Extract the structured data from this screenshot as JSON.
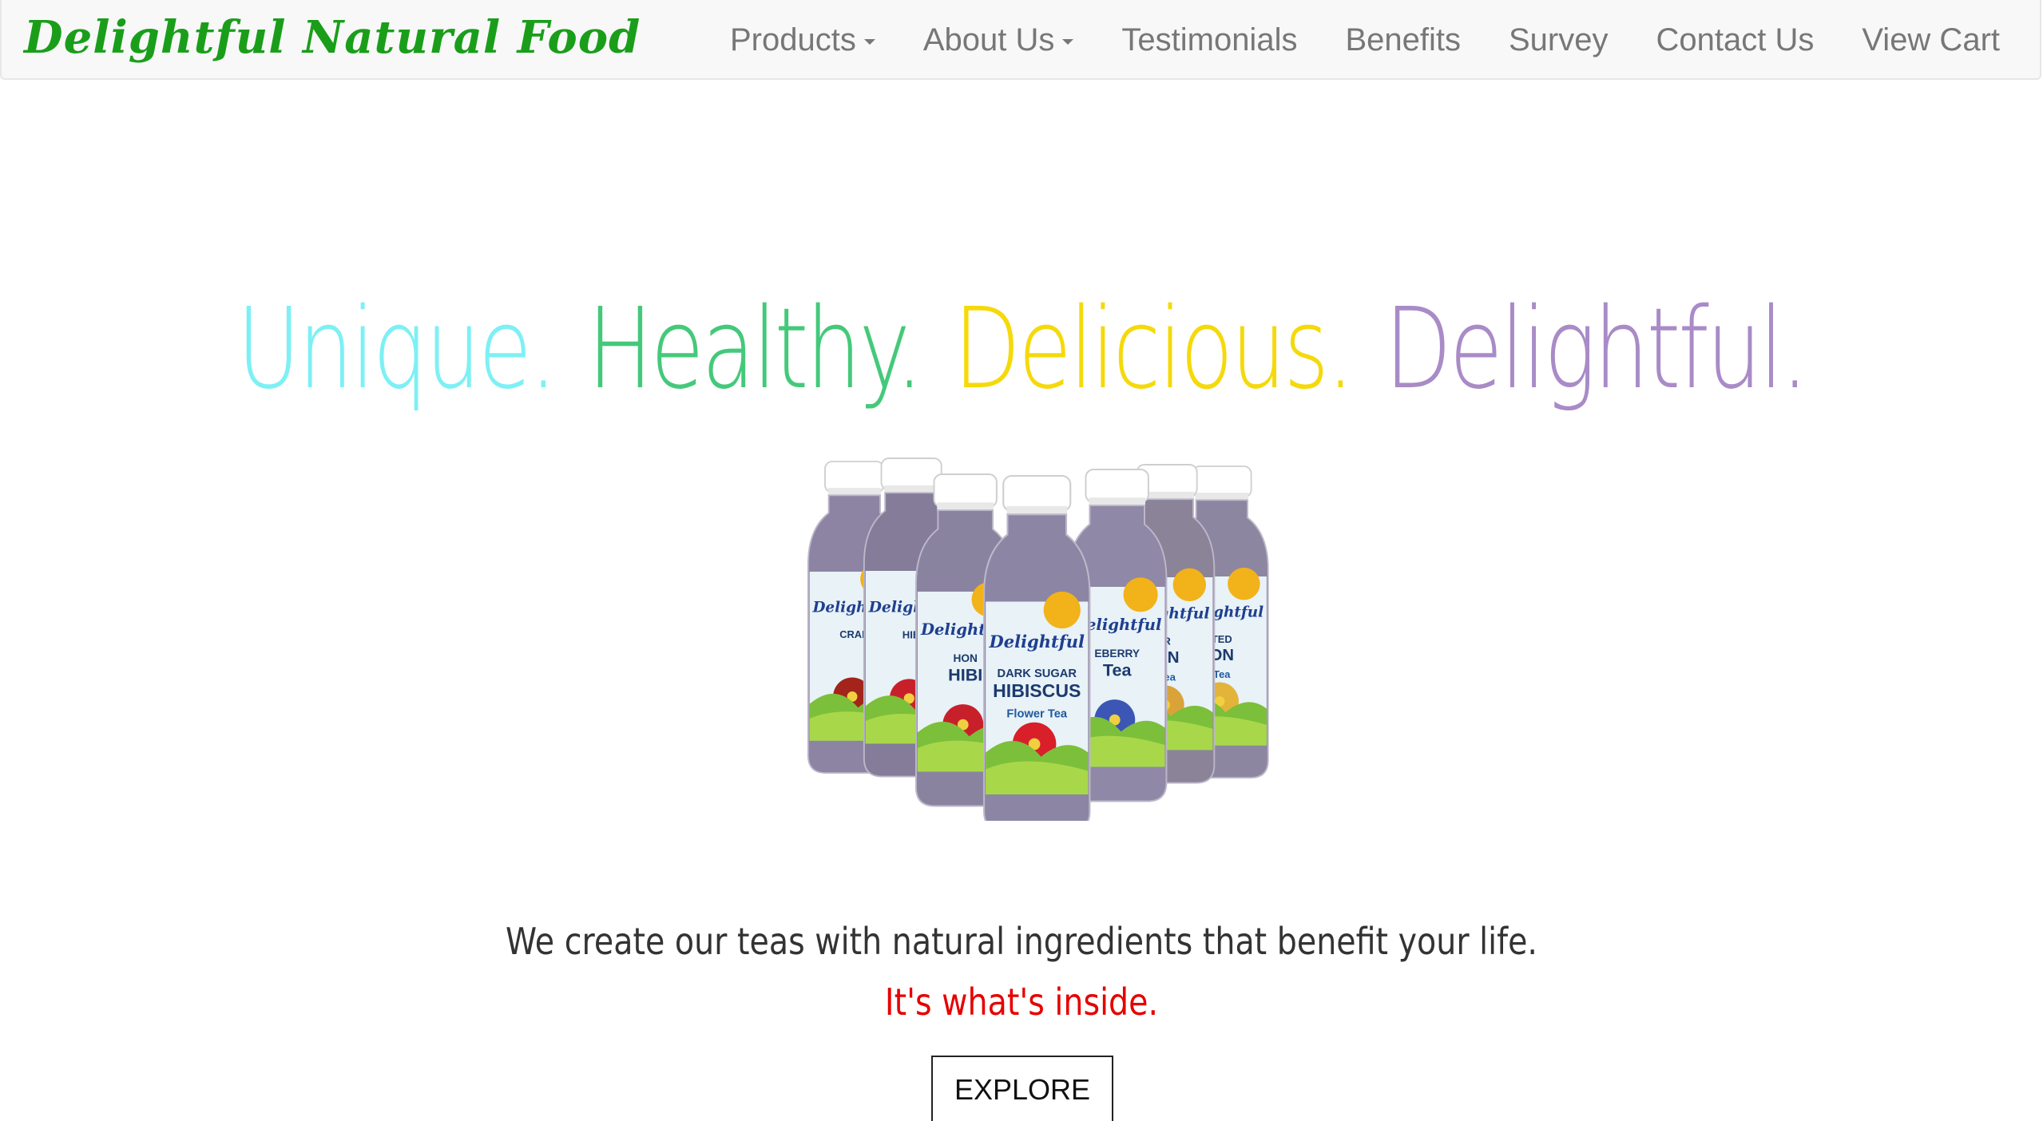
{
  "brand": {
    "name": "Delightful Natural Food",
    "color": "#1a9e1a"
  },
  "nav": {
    "items": [
      {
        "label": "Products",
        "dropdown": true
      },
      {
        "label": "About Us",
        "dropdown": true
      },
      {
        "label": "Testimonials",
        "dropdown": false
      },
      {
        "label": "Benefits",
        "dropdown": false
      },
      {
        "label": "Survey",
        "dropdown": false
      },
      {
        "label": "Contact Us",
        "dropdown": false
      },
      {
        "label": "View Cart",
        "dropdown": false
      }
    ]
  },
  "hero": {
    "words": [
      {
        "text": "Unique.",
        "color": "#7df0f5"
      },
      {
        "text": "Healthy.",
        "color": "#44c97a"
      },
      {
        "text": "Delicious.",
        "color": "#f5d90a"
      },
      {
        "text": "Delightful.",
        "color": "#a98bc7"
      }
    ],
    "bottles": [
      {
        "flavor_line1": "CRAN",
        "flavor_line2": "",
        "flavor_line3": "",
        "cap": "#ffffff",
        "liquid": "#8d84a3",
        "fruit": "#a2241b"
      },
      {
        "flavor_line1": "HIB",
        "flavor_line2": "",
        "flavor_line3": "",
        "cap": "#ffffff",
        "liquid": "#847c99",
        "fruit": "#c8202a"
      },
      {
        "flavor_line1": "HON",
        "flavor_line2": "HIBI",
        "flavor_line3": "",
        "cap": "#ffffff",
        "liquid": "#8a83a0",
        "fruit": "#c8202a"
      },
      {
        "flavor_line1": "DARK SUGAR",
        "flavor_line2": "HIBISCUS",
        "flavor_line3": "Flower Tea",
        "cap": "#ffffff",
        "liquid": "#8c85a4",
        "fruit": "#d81f2a"
      },
      {
        "flavor_line1": "EBERRY",
        "flavor_line2": "Tea",
        "flavor_line3": "",
        "cap": "#ffffff",
        "liquid": "#8f88a6",
        "fruit": "#3b56b5"
      },
      {
        "flavor_line1": "R",
        "flavor_line2": "ON",
        "flavor_line3": "Tea",
        "cap": "#ffffff",
        "liquid": "#8b8398",
        "fruit": "#d9a33a"
      },
      {
        "flavor_line1": "TED",
        "flavor_line2": "ON",
        "flavor_line3": "Tea",
        "cap": "#ffffff",
        "liquid": "#8d86a0",
        "fruit": "#e2b43a"
      }
    ],
    "bottle_brand": "Delightful"
  },
  "tagline": "We create our teas with natural ingredients that benefit your life.",
  "subtagline": "It's what's inside.",
  "cta": {
    "label": "EXPLORE"
  }
}
